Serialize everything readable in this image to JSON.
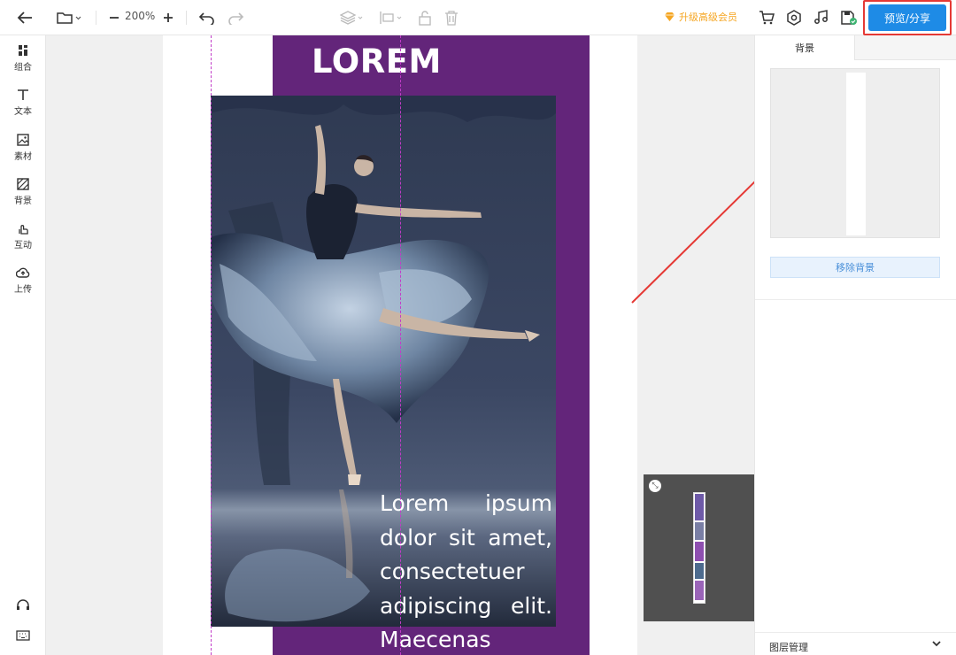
{
  "toolbar": {
    "zoom": "200%",
    "vip_label": "升级高级会员",
    "preview_label": "预览/分享"
  },
  "sidebar": {
    "items": [
      {
        "label": "组合",
        "icon": "combine-icon"
      },
      {
        "label": "文本",
        "icon": "text-icon"
      },
      {
        "label": "素材",
        "icon": "image-icon"
      },
      {
        "label": "背景",
        "icon": "background-icon"
      },
      {
        "label": "互动",
        "icon": "interact-icon"
      },
      {
        "label": "上传",
        "icon": "upload-icon"
      }
    ]
  },
  "canvas": {
    "title": "LOREM",
    "body_lines": [
      "Lorem ipsum",
      "dolor sit amet,",
      "consectetuer",
      "adipiscing elit.",
      "Maecenas"
    ]
  },
  "right_panel": {
    "tab": "背景",
    "remove_bg": "移除背景",
    "layer_manager": "图层管理",
    "layer_toggle": "❯"
  },
  "colors": {
    "accent": "#1e8be6",
    "purple": "#63257a",
    "highlight": "#e53935",
    "vip": "#f5a623"
  }
}
